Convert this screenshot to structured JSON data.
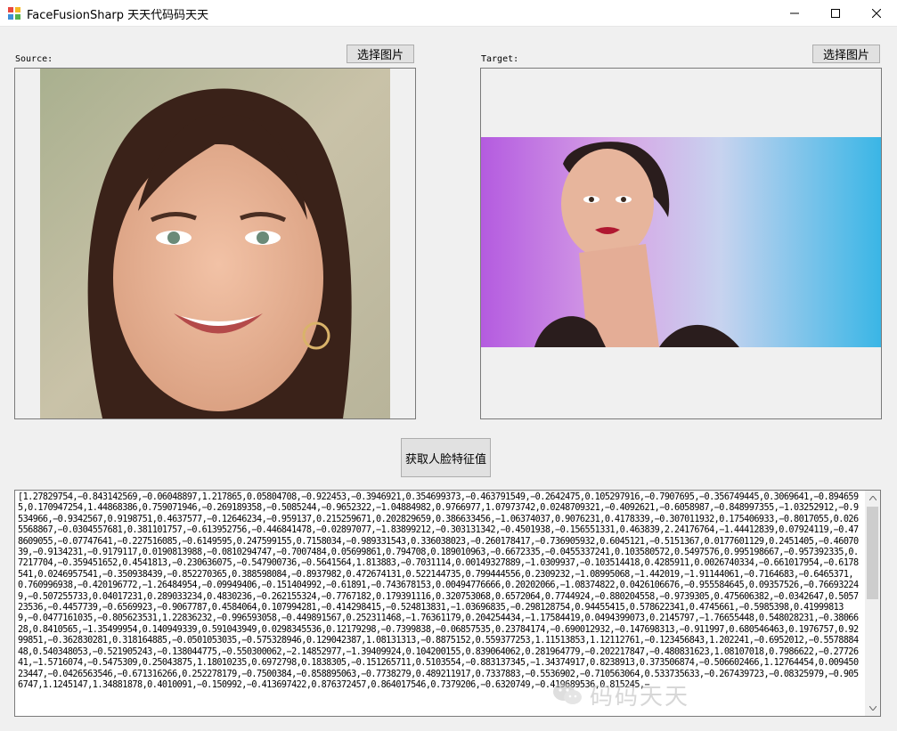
{
  "window": {
    "title": "FaceFusionSharp 天天代码码天天",
    "icon": "app-icon",
    "controls": [
      "minimize-icon",
      "maximize-icon",
      "close-icon"
    ]
  },
  "source": {
    "label": "Source:",
    "select_button": "选择图片"
  },
  "target": {
    "label": "Target:",
    "select_button": "选择图片"
  },
  "actions": {
    "extract_button": "获取人脸特征值"
  },
  "output": {
    "text": "[1.27829754,−0.843142569,−0.06048897,1.217865,0.05804708,−0.922453,−0.3946921,0.354699373,−0.463791549,−0.2642475,0.105297916,−0.7907695,−0.356749445,0.3069641,−0.8946595,0.170947254,1.44868386,0.759071946,−0.269189358,−0.5085244,−0.9652322,−1.04884982,0.9766977,1.07973742,0.0248709321,−0.4092621,−0.6058987,−0.848997355,−1.03252912,−0.9534966,−0.9342567,0.9198751,0.4637577,−0.12646234,−0.959137,0.215259671,0.202829659,0.386633456,−1.06374037,0.9076231,0.4178339,−0.307011932,0.175406933,−0.8017055,0.0265568867,−0.0304557681,0.381101757,−0.613952756,−0.446841478,−0.02897077,−1.83899212,−0.303131342,−0.4501938,−0.156551331,0.463839,2.24176764,−1.44412839,0.07924119,−0.478609055,−0.07747641,−0.227516085,−0.6149595,0.247599155,0.7158034,−0.989331543,0.336038023,−0.260178417,−0.736905932,0.6045121,−0.5151367,0.0177601129,0.2451405,−0.4607039,−0.9134231,−0.9179117,0.0190813988,−0.0810294747,−0.7007484,0.05699861,0.794708,0.189010963,−0.6672335,−0.0455337241,0.103580572,0.5497576,0.995198667,−0.957392335,0.7217704,−0.359451652,0.4541813,−0.230636075,−0.547900736,−0.5641564,1.813883,−0.7031114,0.00149327889,−1.0309937,−0.103514418,0.4285911,0.0026740334,−0.661017954,−0.6178541,0.0246957541,−0.350938439,−0.852270365,0.388598084,−0.8937982,0.472674131,0.522144735,0.799444556,0.2309232,−1.08995068,−1.442019,−1.91144061,−0.7164683,−0.6465371,0.760996938,−0.420196772,−1.26484954,−0.09949406,−0.151404992,−0.61891,−0.743678153,0.00494776666,0.20202066,−1.08374822,0.0426106676,−0.955584645,0.09357526,−0.766932249,−0.507255733,0.04017231,0.289033234,0.4830236,−0.262155324,−0.7767182,0.179391116,0.320753068,0.6572064,0.7744924,−0.880204558,−0.9739305,0.475606382,−0.0342647,0.505723536,−0.4457739,−0.6569923,−0.9067787,0.4584064,0.107994281,−0.414298415,−0.524813831,−1.03696835,−0.298128754,0.94455415,0.578622341,0.4745661,−0.5985398,0.419998139,−0.0477161035,−0.805623531,1.22836232,−0.996593058,−0.449891567,0.252311468,−1.76361179,0.204254434,−1.17584419,0.0494399073,0.2145797,−1.76655448,0.548028231,−0.3806628,0.8410565,−1.35499954,0.140949339,0.591043949,0.0298345536,0.12179298,−0.7399838,−0.06857535,0.23784174,−0.690012932,−0.147698313,−0.911997,0.680546463,0.1976757,0.9299851,−0.362830281,0.318164885,−0.0501053035,−0.575328946,0.129042387,1.08131313,−0.8875152,0.559377253,1.11513853,1.12112761,−0.123456843,1.202241,−0.6952012,−0.557888448,0.540348053,−0.521905243,−0.138044775,−0.550300062,−2.14852977,−1.39409924,0.104200155,0.839064062,0.281964779,−0.202217847,−0.480831623,1.08107018,0.7986622,−0.2772641,−1.5716074,−0.5475309,0.25043875,1.18010235,0.6972798,0.1838305,−0.151265711,0.5103554,−0.883137345,−1.34374917,0.8238913,0.373506874,−0.506602466,1.12764454,0.00945023447,−0.0426563546,−0.671316266,0.252278179,−0.7500384,−0.858895063,−0.7738279,0.489211917,0.7337883,−0.5536902,−0.710563064,0.533735633,−0.267439723,−0.08325979,−0.9056747,1.1245147,1.34881878,0.4010091,−0.150992,−0.413697422,0.876372457,0.864017546,0.7379206,−0.6320749,−0.419689536,0.815245,−"
  },
  "watermark": {
    "text": "码码天天",
    "icon": "wechat-icon"
  },
  "colors": {
    "window_bg": "#f0f0f0",
    "button_bg": "#e1e1e1",
    "border": "#7a7a7a"
  }
}
